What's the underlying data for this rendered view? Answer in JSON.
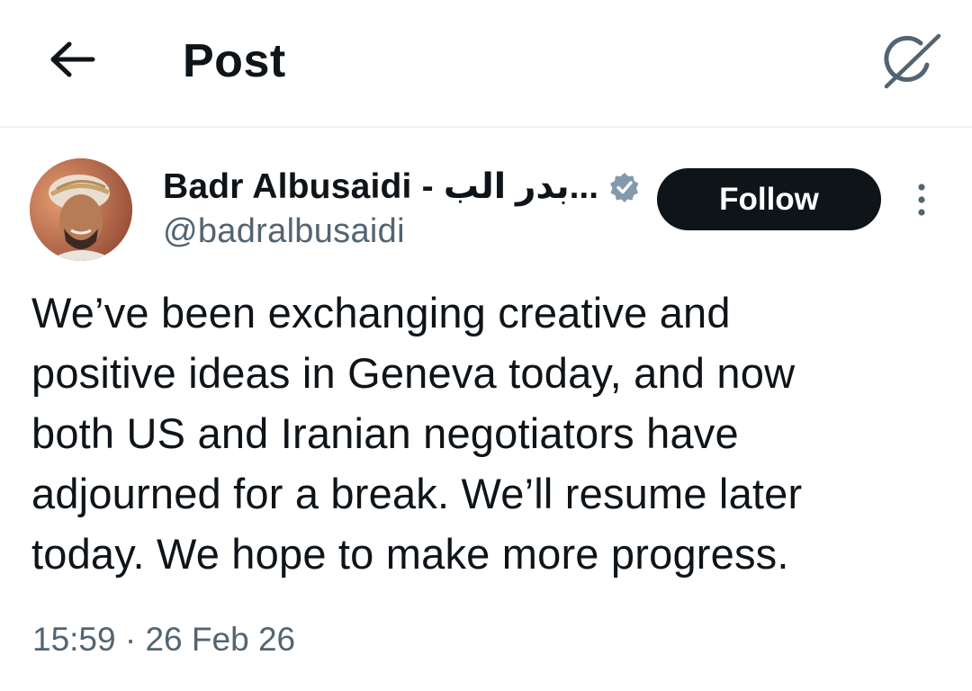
{
  "header": {
    "back_icon": "arrow-left-icon",
    "title": "Post",
    "grok_icon": "grok-icon"
  },
  "author": {
    "display_name": "Badr Albusaidi - بدر الب...",
    "handle": "@badralbusaidi",
    "verified_icon": "verified-badge-icon",
    "verified_color": "#829aab",
    "follow_label": "Follow",
    "more_icon": "more-vertical-icon"
  },
  "post": {
    "lines": [
      "We’ve been exchanging creative and",
      "positive ideas in Geneva today, and now",
      "both US and Iranian negotiators have",
      "adjourned for a break. We’ll resume later",
      "today. We hope to make more progress."
    ],
    "time": "15:59",
    "separator": "·",
    "date": "26 Feb 26"
  },
  "colors": {
    "text_primary": "#0f1419",
    "text_secondary": "#536471",
    "button_dark": "#0f1419",
    "divider": "#eff3f4"
  }
}
